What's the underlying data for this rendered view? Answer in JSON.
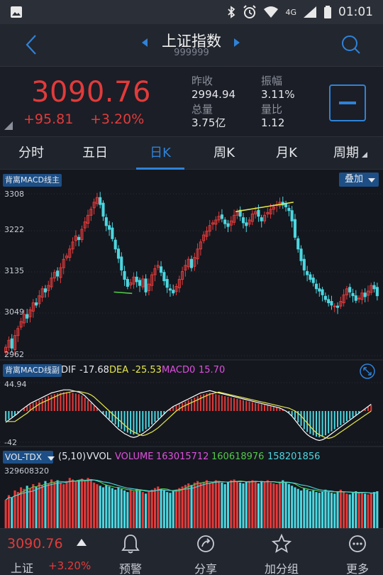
{
  "status_bar": {
    "network": "4G",
    "time": "01:01"
  },
  "header": {
    "title": "上证指数",
    "code": "999999"
  },
  "quote": {
    "price": "3090.76",
    "change": "+95.81",
    "change_pct": "+3.20%",
    "stats": [
      {
        "label": "昨收",
        "value": "2994.94"
      },
      {
        "label": "振幅",
        "value": "3.11%"
      },
      {
        "label": "总量",
        "value": "3.75亿"
      },
      {
        "label": "量比",
        "value": "1.12"
      }
    ]
  },
  "tabs": [
    {
      "label": "分时",
      "active": false
    },
    {
      "label": "五日",
      "active": false
    },
    {
      "label": "日K",
      "active": true
    },
    {
      "label": "周K",
      "active": false
    },
    {
      "label": "月K",
      "active": false
    },
    {
      "label": "周期",
      "active": false
    }
  ],
  "kline": {
    "indicator_badge": "背离MACD线主",
    "overlay_button": "叠加",
    "y_ticks": [
      "3308",
      "3222",
      "3135",
      "3049",
      "2962"
    ]
  },
  "macd": {
    "badge": "背离MACD线副",
    "dif_label": "DIF",
    "dif_value": "-17.68",
    "dea_label": "DEA",
    "dea_value": "-25.53",
    "macd_label": "MACD0",
    "macd_value": "15.70",
    "y_top": "44.94",
    "y_bottom": "-42"
  },
  "volume": {
    "indicator": "VOL-TDX",
    "params": "(5,10)",
    "vvol_label": "VVOL",
    "volume_label": "VOLUME",
    "volume_value": "163015712",
    "ma5_value": "160618976",
    "ma10_value": "158201856",
    "y_top": "329608320"
  },
  "colors": {
    "up": "#e23b3b",
    "down": "#4dd6e0",
    "accent": "#2f82d8",
    "ma_white": "#ffffff",
    "ma_yellow": "#e6e84a",
    "ma_magenta": "#e14fe0",
    "ma_green": "#52c94a"
  },
  "bottom_bar": {
    "name": "上证",
    "price": "3090.76",
    "pct": "+3.20%",
    "nav": [
      {
        "label": "预警",
        "icon": "bell-icon"
      },
      {
        "label": "分享",
        "icon": "share-icon"
      },
      {
        "label": "加分组",
        "icon": "star-icon"
      },
      {
        "label": "更多",
        "icon": "more-icon"
      }
    ]
  },
  "chart_data": {
    "type": "candlestick",
    "ylim": [
      2962,
      3308
    ],
    "close": [
      2980,
      2995,
      2978,
      3005,
      3020,
      3035,
      3050,
      3042,
      3060,
      3075,
      3070,
      3090,
      3105,
      3098,
      3112,
      3128,
      3140,
      3132,
      3150,
      3168,
      3175,
      3190,
      3205,
      3218,
      3210,
      3232,
      3248,
      3262,
      3275,
      3290,
      3300,
      3285,
      3260,
      3240,
      3232,
      3212,
      3190,
      3170,
      3145,
      3125,
      3110,
      3118,
      3130,
      3120,
      3112,
      3126,
      3098,
      3115,
      3135,
      3148,
      3155,
      3140,
      3122,
      3108,
      3102,
      3096,
      3110,
      3125,
      3142,
      3155,
      3168,
      3150,
      3172,
      3190,
      3205,
      3220,
      3228,
      3240,
      3246,
      3252,
      3260,
      3255,
      3244,
      3238,
      3250,
      3262,
      3270,
      3260,
      3246,
      3240,
      3252,
      3265,
      3270,
      3260,
      3250,
      3262,
      3268,
      3275,
      3280,
      3285,
      3290,
      3284,
      3280,
      3272,
      3250,
      3215,
      3190,
      3165,
      3145,
      3135,
      3125,
      3118,
      3105,
      3100,
      3092,
      3082,
      3075,
      3070,
      3068,
      3065,
      3078,
      3092,
      3105,
      3098,
      3090,
      3080,
      3085,
      3096,
      3088,
      3100,
      3112,
      3105,
      3090
    ],
    "macd_hist": [
      -15,
      -12,
      -9,
      -6,
      -3,
      1,
      4,
      7,
      10,
      12,
      14,
      16,
      18,
      20,
      22,
      24,
      25,
      26,
      27,
      28,
      28,
      28,
      27,
      26,
      25,
      23,
      20,
      16,
      12,
      8,
      4,
      0,
      -4,
      -8,
      -12,
      -16,
      -20,
      -24,
      -27,
      -30,
      -32,
      -34,
      -35,
      -34,
      -32,
      -30,
      -27,
      -24,
      -20,
      -16,
      -12,
      -8,
      -4,
      0,
      3,
      6,
      8,
      10,
      12,
      14,
      16,
      18,
      20,
      22,
      24,
      25,
      26,
      27,
      26,
      25,
      24,
      23,
      22,
      21,
      20,
      19,
      18,
      17,
      16,
      15,
      14,
      13,
      12,
      11,
      10,
      9,
      8,
      7,
      6,
      5,
      4,
      2,
      0,
      -3,
      -7,
      -12,
      -17,
      -22,
      -27,
      -31,
      -34,
      -36,
      -38,
      -39,
      -38,
      -36,
      -33,
      -30,
      -27,
      -24,
      -21,
      -18,
      -15,
      -12,
      -9,
      -6,
      -3,
      0,
      3,
      6,
      9
    ],
    "volume": [
      180,
      210,
      195,
      240,
      230,
      260,
      250,
      270,
      255,
      280,
      265,
      290,
      275,
      300,
      285,
      310,
      295,
      305,
      290,
      280,
      300,
      320,
      310,
      295,
      305,
      315,
      300,
      320,
      310,
      290,
      280,
      270,
      260,
      275,
      265,
      255,
      245,
      260,
      250,
      240,
      230,
      245,
      235,
      250,
      240,
      230,
      220,
      235,
      245,
      255,
      265,
      250,
      240,
      230,
      225,
      235,
      245,
      255,
      265,
      275,
      285,
      275,
      290,
      300,
      290,
      295,
      305,
      285,
      295,
      305,
      300,
      290,
      280,
      295,
      305,
      310,
      300,
      290,
      285,
      295,
      300,
      305,
      295,
      285,
      300,
      295,
      305,
      290,
      285,
      280,
      290,
      305,
      295,
      280,
      270,
      260,
      250,
      240,
      255,
      245,
      235,
      240,
      230,
      225,
      235,
      245,
      230,
      225,
      220,
      235,
      245,
      230,
      220,
      215,
      225,
      235,
      230,
      225,
      220,
      215,
      225,
      230,
      235
    ]
  }
}
